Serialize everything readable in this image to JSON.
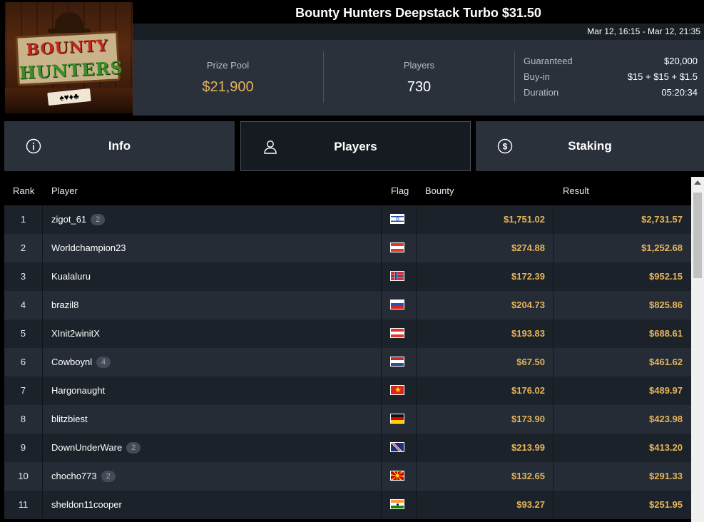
{
  "header": {
    "title": "Bounty Hunters Deepstack Turbo $31.50",
    "date_range": "Mar 12, 16:15 - Mar 12, 21:35",
    "logo_text_top": "BOUNTY",
    "logo_text_bottom": "HUNTERS"
  },
  "stats": {
    "prize_pool_label": "Prize Pool",
    "prize_pool_value": "$21,900",
    "players_label": "Players",
    "players_value": "730",
    "details": [
      {
        "label": "Guaranteed",
        "value": "$20,000"
      },
      {
        "label": "Buy-in",
        "value": "$15 + $15 + $1.5"
      },
      {
        "label": "Duration",
        "value": "05:20:34"
      }
    ]
  },
  "tabs": [
    {
      "label": "Info",
      "icon": "info-icon",
      "active": false
    },
    {
      "label": "Players",
      "icon": "user-icon",
      "active": true
    },
    {
      "label": "Staking",
      "icon": "dollar-coin-icon",
      "active": false
    }
  ],
  "table": {
    "headers": {
      "rank": "Rank",
      "player": "Player",
      "flag": "Flag",
      "bounty": "Bounty",
      "result": "Result"
    },
    "rows": [
      {
        "rank": "1",
        "player": "zigot_61",
        "badge": "2",
        "flag": "israel",
        "bounty": "$1,751.02",
        "result": "$2,731.57"
      },
      {
        "rank": "2",
        "player": "Worldchampion23",
        "badge": "",
        "flag": "austria",
        "bounty": "$274.88",
        "result": "$1,252.68"
      },
      {
        "rank": "3",
        "player": "Kualaluru",
        "badge": "",
        "flag": "norway",
        "bounty": "$172.39",
        "result": "$952.15"
      },
      {
        "rank": "4",
        "player": "brazil8",
        "badge": "",
        "flag": "russia",
        "bounty": "$204.73",
        "result": "$825.86"
      },
      {
        "rank": "5",
        "player": "XInit2winitX",
        "badge": "",
        "flag": "austria",
        "bounty": "$193.83",
        "result": "$688.61"
      },
      {
        "rank": "6",
        "player": "Cowboynl",
        "badge": "4",
        "flag": "netherlands",
        "bounty": "$67.50",
        "result": "$461.62"
      },
      {
        "rank": "7",
        "player": "Hargonaught",
        "badge": "",
        "flag": "vietnam",
        "bounty": "$176.02",
        "result": "$489.97"
      },
      {
        "rank": "8",
        "player": "blitzbiest",
        "badge": "",
        "flag": "germany",
        "bounty": "$173.90",
        "result": "$423.98"
      },
      {
        "rank": "9",
        "player": "DownUnderWare",
        "badge": "2",
        "flag": "new-zealand",
        "bounty": "$213.99",
        "result": "$413.20"
      },
      {
        "rank": "10",
        "player": "chocho773",
        "badge": "2",
        "flag": "north-macedonia",
        "bounty": "$132.65",
        "result": "$291.33"
      },
      {
        "rank": "11",
        "player": "sheldon11cooper",
        "badge": "",
        "flag": "india",
        "bounty": "$93.27",
        "result": "$251.95"
      }
    ]
  },
  "colors": {
    "accent_gold": "#e6b45a",
    "panel": "#2a313b",
    "row_odd": "#1c2229",
    "row_even": "#252c35"
  }
}
